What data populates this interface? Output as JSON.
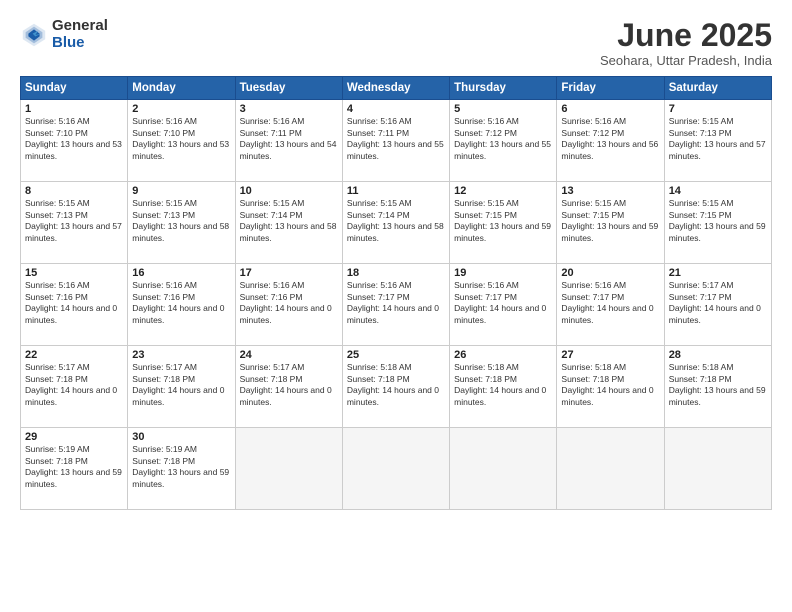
{
  "logo": {
    "general": "General",
    "blue": "Blue"
  },
  "title": "June 2025",
  "subtitle": "Seohara, Uttar Pradesh, India",
  "days_header": [
    "Sunday",
    "Monday",
    "Tuesday",
    "Wednesday",
    "Thursday",
    "Friday",
    "Saturday"
  ],
  "weeks": [
    [
      {
        "day": "1",
        "sunrise": "5:16 AM",
        "sunset": "7:10 PM",
        "daylight": "13 hours and 53 minutes."
      },
      {
        "day": "2",
        "sunrise": "5:16 AM",
        "sunset": "7:10 PM",
        "daylight": "13 hours and 53 minutes."
      },
      {
        "day": "3",
        "sunrise": "5:16 AM",
        "sunset": "7:11 PM",
        "daylight": "13 hours and 54 minutes."
      },
      {
        "day": "4",
        "sunrise": "5:16 AM",
        "sunset": "7:11 PM",
        "daylight": "13 hours and 55 minutes."
      },
      {
        "day": "5",
        "sunrise": "5:16 AM",
        "sunset": "7:12 PM",
        "daylight": "13 hours and 55 minutes."
      },
      {
        "day": "6",
        "sunrise": "5:16 AM",
        "sunset": "7:12 PM",
        "daylight": "13 hours and 56 minutes."
      },
      {
        "day": "7",
        "sunrise": "5:15 AM",
        "sunset": "7:13 PM",
        "daylight": "13 hours and 57 minutes."
      }
    ],
    [
      {
        "day": "8",
        "sunrise": "5:15 AM",
        "sunset": "7:13 PM",
        "daylight": "13 hours and 57 minutes."
      },
      {
        "day": "9",
        "sunrise": "5:15 AM",
        "sunset": "7:13 PM",
        "daylight": "13 hours and 58 minutes."
      },
      {
        "day": "10",
        "sunrise": "5:15 AM",
        "sunset": "7:14 PM",
        "daylight": "13 hours and 58 minutes."
      },
      {
        "day": "11",
        "sunrise": "5:15 AM",
        "sunset": "7:14 PM",
        "daylight": "13 hours and 58 minutes."
      },
      {
        "day": "12",
        "sunrise": "5:15 AM",
        "sunset": "7:15 PM",
        "daylight": "13 hours and 59 minutes."
      },
      {
        "day": "13",
        "sunrise": "5:15 AM",
        "sunset": "7:15 PM",
        "daylight": "13 hours and 59 minutes."
      },
      {
        "day": "14",
        "sunrise": "5:15 AM",
        "sunset": "7:15 PM",
        "daylight": "13 hours and 59 minutes."
      }
    ],
    [
      {
        "day": "15",
        "sunrise": "5:16 AM",
        "sunset": "7:16 PM",
        "daylight": "14 hours and 0 minutes."
      },
      {
        "day": "16",
        "sunrise": "5:16 AM",
        "sunset": "7:16 PM",
        "daylight": "14 hours and 0 minutes."
      },
      {
        "day": "17",
        "sunrise": "5:16 AM",
        "sunset": "7:16 PM",
        "daylight": "14 hours and 0 minutes."
      },
      {
        "day": "18",
        "sunrise": "5:16 AM",
        "sunset": "7:17 PM",
        "daylight": "14 hours and 0 minutes."
      },
      {
        "day": "19",
        "sunrise": "5:16 AM",
        "sunset": "7:17 PM",
        "daylight": "14 hours and 0 minutes."
      },
      {
        "day": "20",
        "sunrise": "5:16 AM",
        "sunset": "7:17 PM",
        "daylight": "14 hours and 0 minutes."
      },
      {
        "day": "21",
        "sunrise": "5:17 AM",
        "sunset": "7:17 PM",
        "daylight": "14 hours and 0 minutes."
      }
    ],
    [
      {
        "day": "22",
        "sunrise": "5:17 AM",
        "sunset": "7:18 PM",
        "daylight": "14 hours and 0 minutes."
      },
      {
        "day": "23",
        "sunrise": "5:17 AM",
        "sunset": "7:18 PM",
        "daylight": "14 hours and 0 minutes."
      },
      {
        "day": "24",
        "sunrise": "5:17 AM",
        "sunset": "7:18 PM",
        "daylight": "14 hours and 0 minutes."
      },
      {
        "day": "25",
        "sunrise": "5:18 AM",
        "sunset": "7:18 PM",
        "daylight": "14 hours and 0 minutes."
      },
      {
        "day": "26",
        "sunrise": "5:18 AM",
        "sunset": "7:18 PM",
        "daylight": "14 hours and 0 minutes."
      },
      {
        "day": "27",
        "sunrise": "5:18 AM",
        "sunset": "7:18 PM",
        "daylight": "14 hours and 0 minutes."
      },
      {
        "day": "28",
        "sunrise": "5:18 AM",
        "sunset": "7:18 PM",
        "daylight": "13 hours and 59 minutes."
      }
    ],
    [
      {
        "day": "29",
        "sunrise": "5:19 AM",
        "sunset": "7:18 PM",
        "daylight": "13 hours and 59 minutes."
      },
      {
        "day": "30",
        "sunrise": "5:19 AM",
        "sunset": "7:18 PM",
        "daylight": "13 hours and 59 minutes."
      },
      null,
      null,
      null,
      null,
      null
    ]
  ]
}
